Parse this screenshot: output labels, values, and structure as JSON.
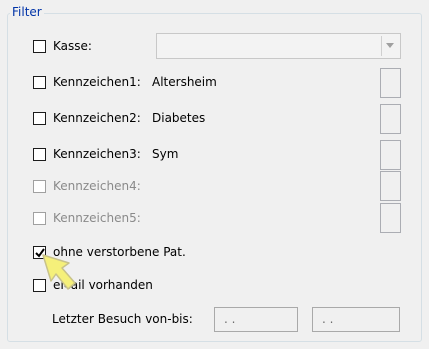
{
  "filter": {
    "title": "Filter",
    "kasse": {
      "label": "Kasse:",
      "checked": false,
      "value": ""
    },
    "flags": [
      {
        "label": "Kennzeichen1:",
        "value": "Altersheim",
        "checked": false,
        "enabled": true
      },
      {
        "label": "Kennzeichen2:",
        "value": "Diabetes",
        "checked": false,
        "enabled": true
      },
      {
        "label": "Kennzeichen3:",
        "value": "Sym",
        "checked": false,
        "enabled": true
      },
      {
        "label": "Kennzeichen4:",
        "value": "",
        "checked": false,
        "enabled": false
      },
      {
        "label": "Kennzeichen5:",
        "value": "",
        "checked": false,
        "enabled": false
      }
    ],
    "deceased": {
      "label": "ohne verstorbene Pat.",
      "checked": true
    },
    "email": {
      "label": "eMail vorhanden",
      "checked": false
    },
    "last_visit": {
      "label": "Letzter Besuch von-bis:",
      "from": ". .",
      "to": ". ."
    }
  }
}
